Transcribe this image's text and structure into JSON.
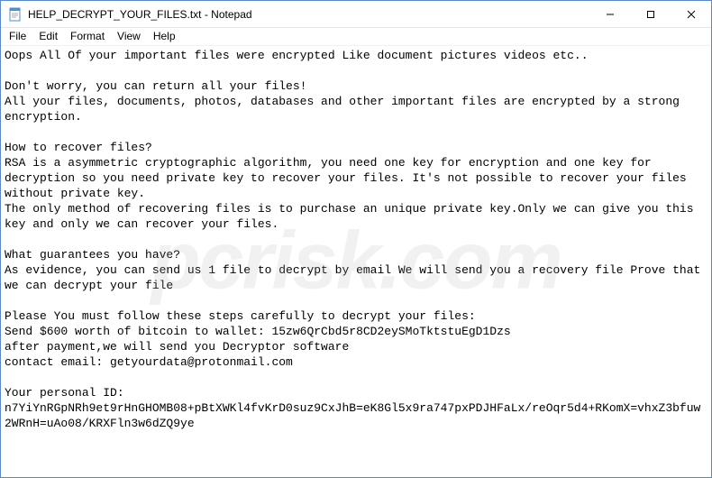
{
  "window": {
    "title": "HELP_DECRYPT_YOUR_FILES.txt - Notepad",
    "app_icon": "notepad-icon"
  },
  "win_controls": {
    "minimize": "—",
    "maximize": "☐",
    "close": "✕"
  },
  "menubar": {
    "items": [
      "File",
      "Edit",
      "Format",
      "View",
      "Help"
    ]
  },
  "content": {
    "text": "Oops All Of your important files were encrypted Like document pictures videos etc..\n\nDon't worry, you can return all your files!\nAll your files, documents, photos, databases and other important files are encrypted by a strong encryption.\n\nHow to recover files?\nRSA is a asymmetric cryptographic algorithm, you need one key for encryption and one key for decryption so you need private key to recover your files. It's not possible to recover your files without private key.\nThe only method of recovering files is to purchase an unique private key.Only we can give you this key and only we can recover your files.\n\nWhat guarantees you have?\nAs evidence, you can send us 1 file to decrypt by email We will send you a recovery file Prove that we can decrypt your file\n\nPlease You must follow these steps carefully to decrypt your files:\nSend $600 worth of bitcoin to wallet: 15zw6QrCbd5r8CD2eySMoTktstuEgD1Dzs\nafter payment,we will send you Decryptor software\ncontact email: getyourdata@protonmail.com\n\nYour personal ID:\nn7YiYnRGpNRh9et9rHnGHOMB08+pBtXWKl4fvKrD0suz9CxJhB=eK8Gl5x9ra747pxPDJHFaLx/reOqr5d4+RKomX=vhxZ3bfuw2WRnH=uAo08/KRXFln3w6dZQ9ye"
  },
  "watermark": {
    "text": "pcrisk.com"
  }
}
